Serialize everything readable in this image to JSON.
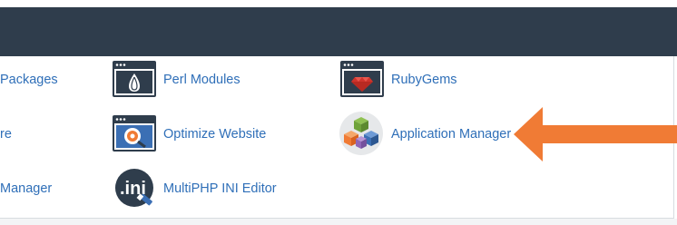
{
  "header": {
    "title": ""
  },
  "section": {
    "items": [
      {
        "name": "partial-packages",
        "label": "Packages",
        "icon": "package-icon"
      },
      {
        "name": "partial-re",
        "label": "re",
        "icon": "software-icon"
      },
      {
        "name": "partial-manager",
        "label": "Manager",
        "icon": "manager-icon"
      },
      {
        "name": "perl-modules",
        "label": "Perl Modules",
        "icon": "perl-onion-icon"
      },
      {
        "name": "optimize-website",
        "label": "Optimize Website",
        "icon": "optimize-gear-icon"
      },
      {
        "name": "multiphp-ini-editor",
        "label": "MultiPHP INI Editor",
        "icon": "ini-editor-icon"
      },
      {
        "name": "rubygems",
        "label": "RubyGems",
        "icon": "ruby-gem-icon"
      },
      {
        "name": "application-manager",
        "label": "Application Manager",
        "icon": "application-cubes-icon"
      }
    ]
  },
  "annotation": {
    "arrow_color": "#f07b35",
    "icon": "orange-arrow-icon"
  },
  "colors": {
    "header_bg": "#2f3d4c",
    "link": "#2f6fb8",
    "icon_dark": "#2f3d4c",
    "icon_blue": "#3b6fb4"
  }
}
